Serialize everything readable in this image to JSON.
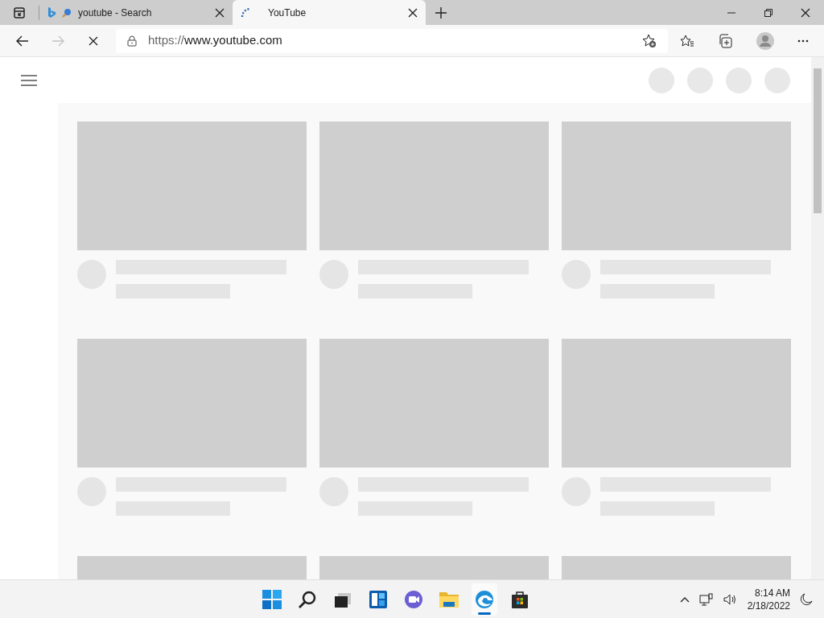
{
  "tabs": [
    {
      "title": "youtube - Search",
      "selected": false,
      "loading": false
    },
    {
      "title": "YouTube",
      "selected": true,
      "loading": true
    }
  ],
  "toolbar": {
    "back_disabled": false,
    "forward_disabled": true,
    "loading": true,
    "url_scheme": "https://",
    "url_host": "www.youtube.com"
  },
  "feed": {
    "placeholders": [
      {
        "kind": "video"
      },
      {
        "kind": "video"
      },
      {
        "kind": "video"
      },
      {
        "kind": "video"
      },
      {
        "kind": "video"
      },
      {
        "kind": "video"
      },
      {
        "kind": "thumbnail"
      },
      {
        "kind": "thumbnail"
      },
      {
        "kind": "thumbnail"
      }
    ]
  },
  "taskbar": {
    "apps": [
      {
        "kind": "start",
        "active": false
      },
      {
        "kind": "search",
        "active": false
      },
      {
        "kind": "taskview",
        "active": false
      },
      {
        "kind": "widgets",
        "active": false
      },
      {
        "kind": "chat",
        "active": false
      },
      {
        "kind": "explorer",
        "active": false
      },
      {
        "kind": "edge",
        "active": true
      },
      {
        "kind": "store",
        "active": false
      }
    ],
    "time": "8:14 AM",
    "date": "2/18/2022"
  }
}
